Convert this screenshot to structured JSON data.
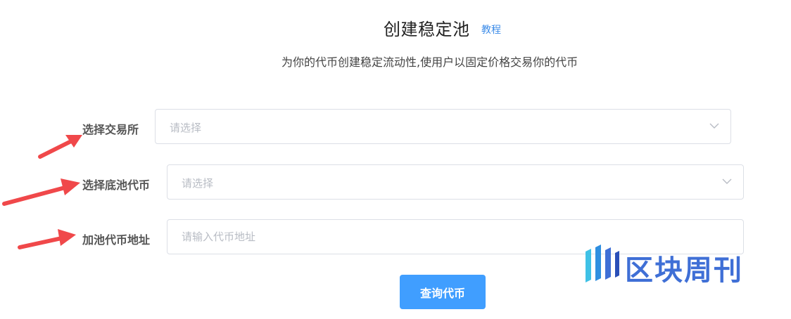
{
  "header": {
    "title": "创建稳定池",
    "tutorial_link": "教程",
    "subtitle": "为你的代币创建稳定流动性,使用户以固定价格交易你的代币"
  },
  "form": {
    "exchange": {
      "label": "选择交易所",
      "placeholder": "请选择"
    },
    "base_token": {
      "label": "选择底池代币",
      "placeholder": "请选择"
    },
    "token_address": {
      "label": "加池代币地址",
      "placeholder": "请输入代币地址",
      "value": ""
    }
  },
  "actions": {
    "query_button": "查询代币"
  },
  "watermark": {
    "text": "区块周刊"
  },
  "colors": {
    "primary": "#409eff",
    "link": "#3b8be8",
    "annotation_arrow": "#f0484a",
    "border": "#dcdfe6",
    "watermark": "#3f6fd6"
  },
  "icons": [
    "chevron-down-icon",
    "annotation-arrow-icon",
    "watermark-logo-icon"
  ]
}
